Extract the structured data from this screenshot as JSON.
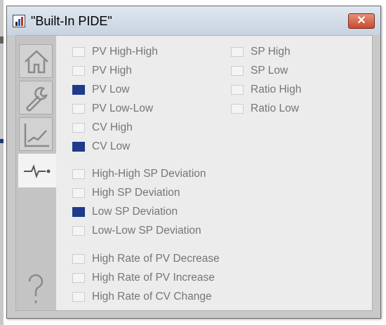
{
  "window": {
    "title": "\"Built-In PIDE\""
  },
  "close": {
    "symbol": "✕"
  },
  "sidebar": {
    "items": [
      {
        "id": "home",
        "icon": "home-icon"
      },
      {
        "id": "maintenance",
        "icon": "wrench-icon"
      },
      {
        "id": "trends",
        "icon": "trend-chart-icon"
      },
      {
        "id": "alarms",
        "icon": "pulse-icon",
        "active": true
      }
    ],
    "help_symbol": "?"
  },
  "alarms": {
    "pv": [
      {
        "label": "PV High-High",
        "checked": false
      },
      {
        "label": "PV High",
        "checked": false
      },
      {
        "label": "PV Low",
        "checked": true
      },
      {
        "label": "PV Low-Low",
        "checked": false
      },
      {
        "label": "CV High",
        "checked": false
      },
      {
        "label": "CV Low",
        "checked": true
      }
    ],
    "sp": [
      {
        "label": "SP High",
        "checked": false
      },
      {
        "label": "SP Low",
        "checked": false
      },
      {
        "label": "Ratio High",
        "checked": false
      },
      {
        "label": "Ratio Low",
        "checked": false
      }
    ],
    "deviation": [
      {
        "label": "High-High SP Deviation",
        "checked": false
      },
      {
        "label": "High SP Deviation",
        "checked": false
      },
      {
        "label": "Low SP Deviation",
        "checked": true
      },
      {
        "label": "Low-Low SP Deviation",
        "checked": false
      }
    ],
    "rate": [
      {
        "label": "High Rate of PV Decrease",
        "checked": false
      },
      {
        "label": "High Rate of PV Increase",
        "checked": false
      },
      {
        "label": "High Rate of CV Change",
        "checked": false
      }
    ]
  },
  "colors": {
    "checked": "#1f3a8a",
    "label": "#767676",
    "sidebar": "#c4c4c4",
    "panel": "#ececec"
  }
}
